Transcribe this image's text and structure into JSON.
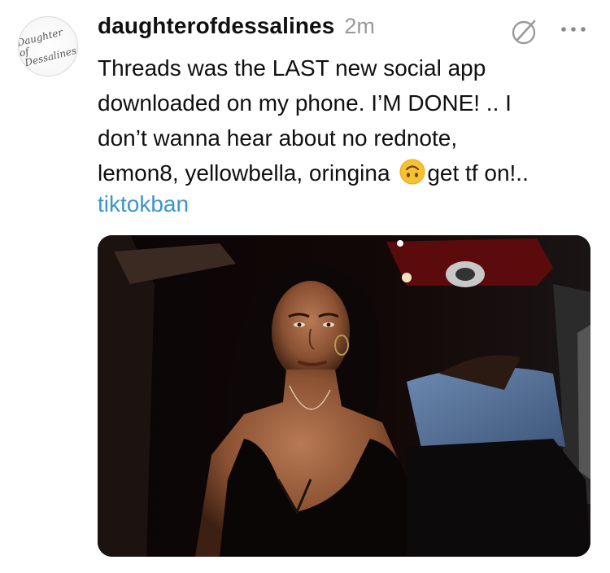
{
  "post": {
    "username": "daughterofdessalines",
    "time": "2m",
    "avatar_text": [
      "Daughter of",
      "Dessalines"
    ],
    "body_before_emoji": "Threads was the LAST new social app\ndownloaded on my phone. I’M DONE! .. I\ndon’t wanna hear about no rednote,\nlemon8, yellowbella, oringina ",
    "body_after_emoji": "get tf on!..",
    "hashtag": "tiktokban",
    "emoji": "upside-down-face-icon",
    "media": "gif-image"
  },
  "icons": {
    "edit": "edit-slash-icon",
    "more": "more-options-icon"
  },
  "colors": {
    "text": "#101010",
    "muted": "#999999",
    "link": "#3a96c9",
    "emoji": "#f6c231"
  }
}
